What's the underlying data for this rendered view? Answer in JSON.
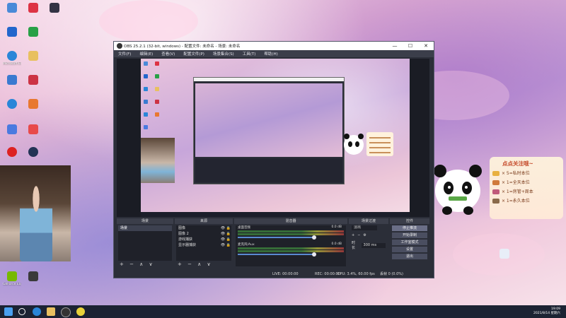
{
  "desktop": {
    "icons": [
      {
        "label": "",
        "color": "#4a8ad8"
      },
      {
        "label": "",
        "color": "#dd3344"
      },
      {
        "label": "",
        "color": "#333344"
      },
      {
        "label": "",
        "color": "#2266cc"
      },
      {
        "label": "",
        "color": "#28a046"
      },
      {
        "label": "Microsoft Edge",
        "color": "#2a86d8"
      },
      {
        "label": "",
        "color": "#e8c060"
      },
      {
        "label": "",
        "color": "#3a7ad0"
      },
      {
        "label": "",
        "color": "#cc3344"
      },
      {
        "label": "",
        "color": "#2a86d8"
      },
      {
        "label": "",
        "color": "#e87830"
      },
      {
        "label": "",
        "color": "#e84a4a"
      },
      {
        "label": "",
        "color": "#4a7ae0"
      },
      {
        "label": "",
        "color": "#dd2222"
      },
      {
        "label": "",
        "color": "#223355"
      },
      {
        "label": "QQ",
        "color": "#3a8ad8"
      },
      {
        "label": "GeForce Experience",
        "color": "#76b900"
      },
      {
        "label": "",
        "color": "#3a3a3a"
      }
    ],
    "right_icon_label": ""
  },
  "obs": {
    "title": "OBS 25.2.1 (32-bit, windows) - 配置文件: 未命名 - 场景: 未命名",
    "menu": [
      "文件(F)",
      "编辑(E)",
      "查看(V)",
      "配置文件(P)",
      "场景集合(S)",
      "工具(T)",
      "帮助(H)"
    ],
    "win_buttons": {
      "minimize": "—",
      "maximize": "☐",
      "close": "✕"
    },
    "docks": {
      "scenes_title": "场景",
      "sources_title": "来源",
      "mixer_title": "混音器",
      "transitions_title": "场景过渡",
      "controls_title": "控件"
    },
    "scenes": [
      "场景"
    ],
    "sources": [
      "图像",
      "图像 2",
      "游戏捕获",
      "显示器捕获"
    ],
    "mixer": [
      {
        "name": "桌面音频",
        "db": "0.0 dB",
        "level": 0.72
      },
      {
        "name": "麦克风/Aux",
        "db": "0.0 dB",
        "level": 0.72
      }
    ],
    "transition": {
      "type": "淡出",
      "duration_label": "时长",
      "duration": "300 ms"
    },
    "controls": [
      "停止推流",
      "开始录制",
      "工作室模式",
      "设置",
      "退出"
    ],
    "dock_footer": "+ − ∧ ∨",
    "status": {
      "live": "LIVE: 00:00:00",
      "rec": "REC: 00:00:00",
      "cpu": "CPU: 3.4%, 60.00 fps",
      "dropped": "丢帧 0 (0.0%)"
    }
  },
  "sticker": {
    "title": "点点关注哦~",
    "items": [
      {
        "text": "× 5=私时本位",
        "color": "#e8b040"
      },
      {
        "text": "× 1=全天本位",
        "color": "#d07a3a"
      },
      {
        "text": "× 1=房管+周本",
        "color": "#c05a7a"
      },
      {
        "text": "× 1=永久本位",
        "color": "#8a6a4a"
      }
    ]
  },
  "taskbar": {
    "time": "19:09",
    "date": "2021/8/14 星期六",
    "accent": "#1c2333"
  }
}
